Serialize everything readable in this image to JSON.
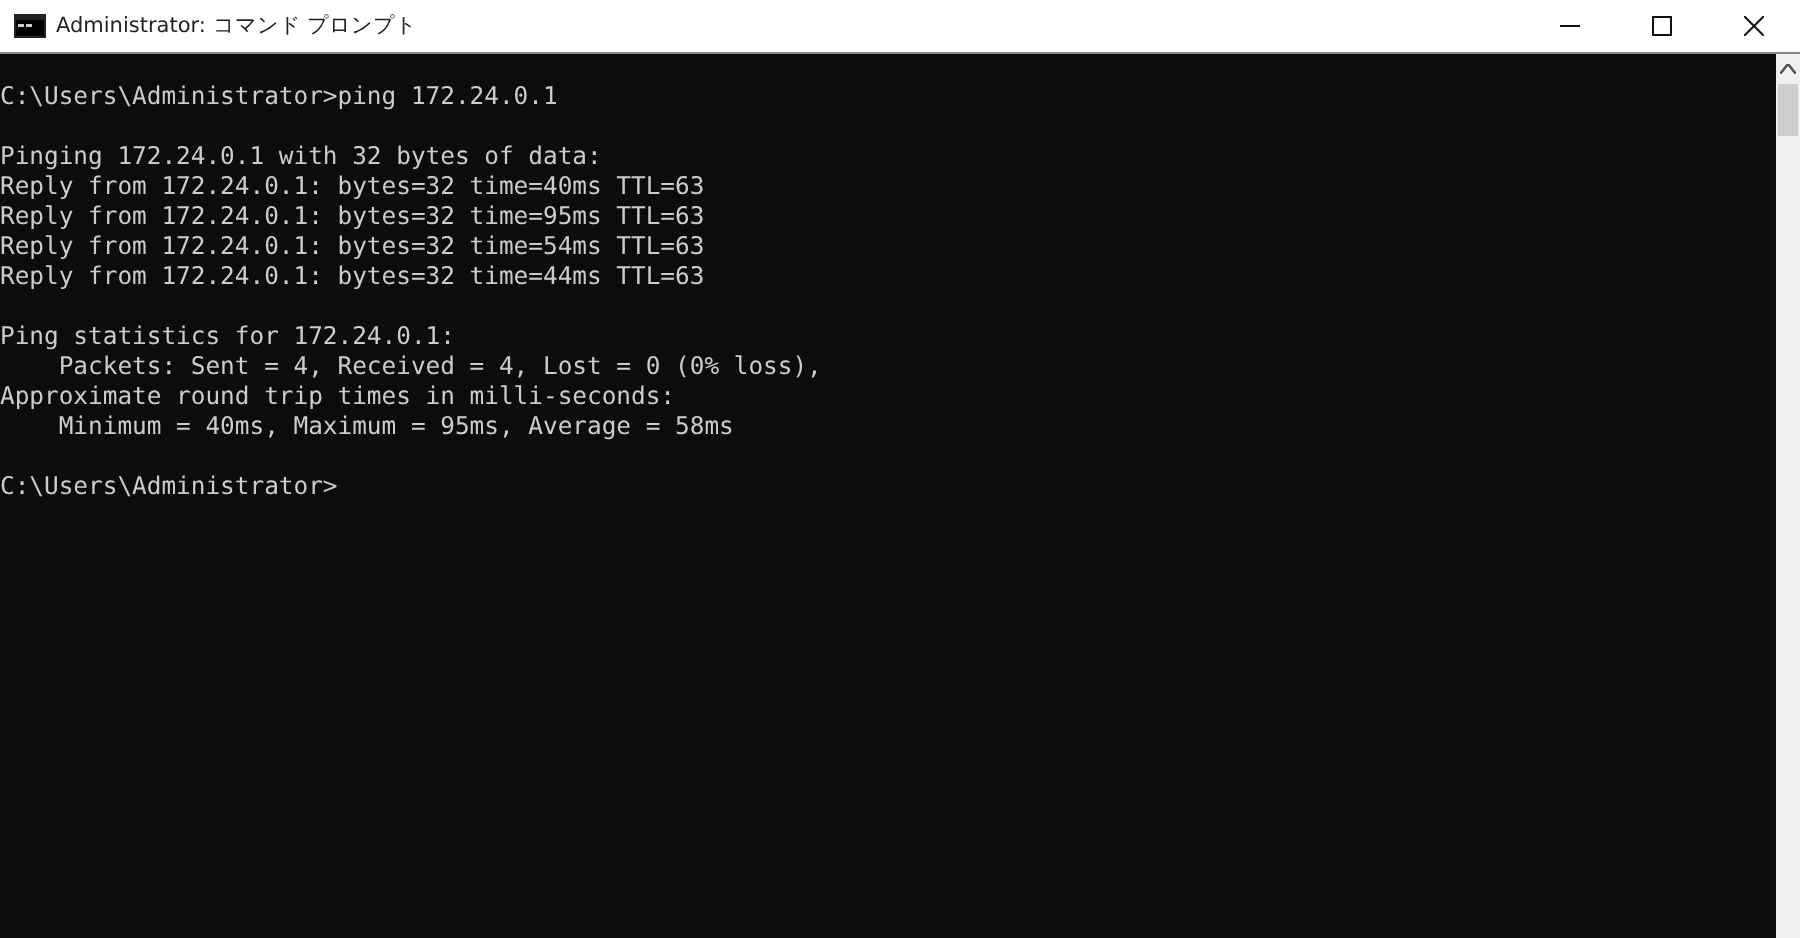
{
  "window": {
    "title": "Administrator: コマンド プロンプト"
  },
  "console": {
    "blocks": [
      [
        "C:\\Users\\Administrator>ping 172.24.0.1"
      ],
      [
        "Pinging 172.24.0.1 with 32 bytes of data:",
        "Reply from 172.24.0.1: bytes=32 time=40ms TTL=63",
        "Reply from 172.24.0.1: bytes=32 time=95ms TTL=63",
        "Reply from 172.24.0.1: bytes=32 time=54ms TTL=63",
        "Reply from 172.24.0.1: bytes=32 time=44ms TTL=63"
      ],
      [
        "Ping statistics for 172.24.0.1:",
        "    Packets: Sent = 4, Received = 4, Lost = 0 (0% loss),",
        "Approximate round trip times in milli-seconds:",
        "    Minimum = 40ms, Maximum = 95ms, Average = 58ms"
      ],
      [
        "C:\\Users\\Administrator>"
      ]
    ]
  }
}
